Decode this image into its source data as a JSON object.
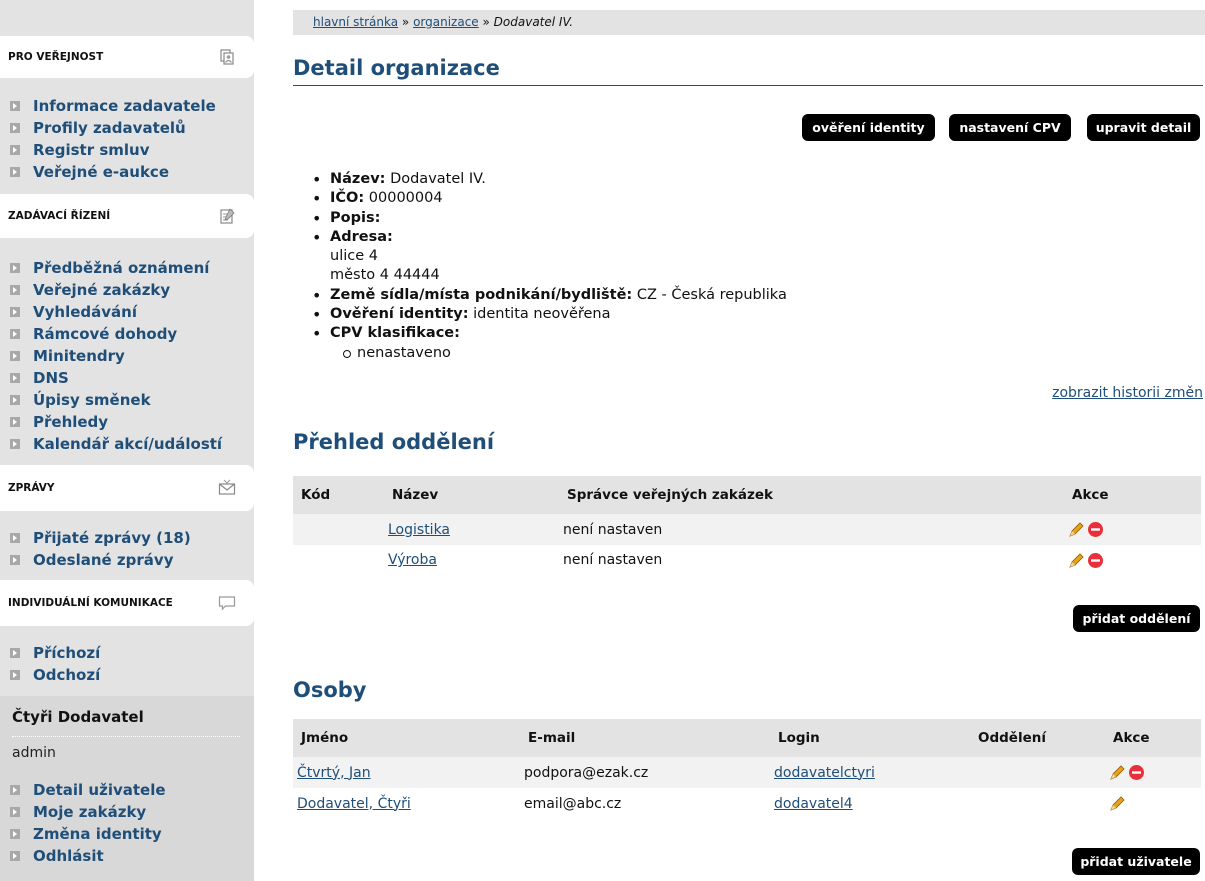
{
  "sidebar": {
    "sections": [
      {
        "title": "PRO VEŘEJNOST",
        "icon": "people-icon",
        "items": [
          "Informace zadavatele",
          "Profily zadavatelů",
          "Registr smluv",
          "Veřejné e-aukce"
        ]
      },
      {
        "title": "ZADÁVACÍ ŘÍZENÍ",
        "icon": "notepad-icon",
        "items": [
          "Předběžná oznámení",
          "Veřejné zakázky",
          "Vyhledávání",
          "Rámcové dohody",
          "Minitendry",
          "DNS",
          "Úpisy směnek",
          "Přehledy",
          "Kalendář akcí/událostí"
        ]
      },
      {
        "title": "ZPRÁVY",
        "icon": "envelope-icon",
        "items": [
          "Přijaté zprávy (18)",
          "Odeslané zprávy"
        ]
      },
      {
        "title": "INDIVIDUÁLNÍ KOMUNIKACE",
        "icon": "speech-bubble-icon",
        "items": [
          "Příchozí",
          "Odchozí"
        ]
      }
    ],
    "user": {
      "name": "Čtyři Dodavatel",
      "role": "admin",
      "items": [
        "Detail uživatele",
        "Moje zakázky",
        "Změna identity",
        "Odhlásit"
      ]
    }
  },
  "breadcrumb": {
    "home": "hlavní stránka",
    "sep1": " » ",
    "org": "organizace",
    "sep2": " » ",
    "current": "Dodavatel IV."
  },
  "page_title": "Detail organizace",
  "buttons": {
    "verify": "ověření identity",
    "cpv": "nastavení CPV",
    "edit": "upravit detail"
  },
  "details": {
    "name_label": "Název:",
    "name_value": "Dodavatel IV.",
    "ico_label": "IČO:",
    "ico_value": "00000004",
    "desc_label": "Popis:",
    "address_label": "Adresa:",
    "address_line1": "ulice 4",
    "address_line2": "město 4 44444",
    "country_label": "Země sídla/místa podnikání/bydliště:",
    "country_value": "CZ - Česká republika",
    "verify_label": "Ověření identity:",
    "verify_value": "identita neověřena",
    "cpv_label": "CPV klasifikace:",
    "cpv_value": "nenastaveno"
  },
  "history_link": "zobrazit historii změn",
  "departments": {
    "title": "Přehled oddělení",
    "headers": [
      "Kód",
      "Název",
      "Správce veřejných zakázek",
      "Akce"
    ],
    "rows": [
      {
        "code": "",
        "name": "Logistika",
        "manager": "není nastaven"
      },
      {
        "code": "",
        "name": "Výroba",
        "manager": "není nastaven"
      }
    ],
    "add_button": "přidat oddělení"
  },
  "persons": {
    "title": "Osoby",
    "headers": [
      "Jméno",
      "E-mail",
      "Login",
      "Oddělení",
      "Akce"
    ],
    "rows": [
      {
        "name": "Čtvrtý, Jan",
        "email": "podpora@ezak.cz",
        "login": "dodavatelctyri",
        "dept": ""
      },
      {
        "name": "Dodavatel, Čtyři",
        "email": "email@abc.cz",
        "login": "dodavatel4",
        "dept": ""
      }
    ],
    "add_button": "přidat uživatele"
  },
  "colors": {
    "link": "#1f4e79",
    "sidebar_bg": "#e3e3e3",
    "button_bg": "#000000",
    "delete": "#e8303a",
    "pencil": "#e8a317"
  }
}
